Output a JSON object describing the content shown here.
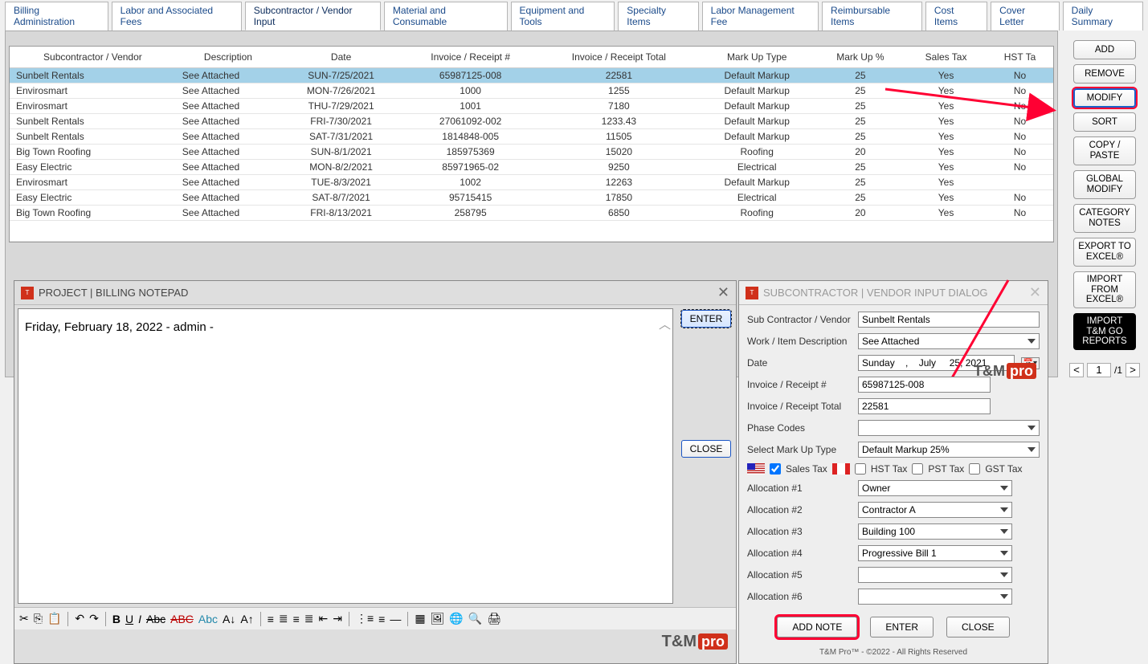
{
  "tabs": [
    {
      "label": "Billing Administration"
    },
    {
      "label": "Labor and Associated Fees"
    },
    {
      "label": "Subcontractor / Vendor Input",
      "active": true
    },
    {
      "label": "Material and Consumable"
    },
    {
      "label": "Equipment and Tools"
    },
    {
      "label": "Specialty Items"
    },
    {
      "label": "Labor Management Fee"
    },
    {
      "label": "Reimbursable Items"
    },
    {
      "label": "Cost Items"
    },
    {
      "label": "Cover Letter"
    },
    {
      "label": "Daily Summary"
    }
  ],
  "grid": {
    "columns": [
      "Subcontractor / Vendor",
      "Description",
      "Date",
      "Invoice / Receipt #",
      "Invoice / Receipt Total",
      "Mark Up Type",
      "Mark Up %",
      "Sales Tax",
      "HST Ta"
    ],
    "rows": [
      {
        "sel": true,
        "c": [
          "Sunbelt Rentals",
          "See Attached",
          "SUN-7/25/2021",
          "65987125-008",
          "22581",
          "Default Markup",
          "25",
          "Yes",
          "No"
        ]
      },
      {
        "c": [
          "Envirosmart",
          "See Attached",
          "MON-7/26/2021",
          "1000",
          "1255",
          "Default Markup",
          "25",
          "Yes",
          "No"
        ]
      },
      {
        "c": [
          "Envirosmart",
          "See Attached",
          "THU-7/29/2021",
          "1001",
          "7180",
          "Default Markup",
          "25",
          "Yes",
          "No"
        ]
      },
      {
        "c": [
          "Sunbelt Rentals",
          "See Attached",
          "FRI-7/30/2021",
          "27061092-002",
          "1233.43",
          "Default Markup",
          "25",
          "Yes",
          "No"
        ]
      },
      {
        "c": [
          "Sunbelt Rentals",
          "See Attached",
          "SAT-7/31/2021",
          "1814848-005",
          "11505",
          "Default Markup",
          "25",
          "Yes",
          "No"
        ]
      },
      {
        "c": [
          "Big Town Roofing",
          "See Attached",
          "SUN-8/1/2021",
          "185975369",
          "15020",
          "Roofing",
          "20",
          "Yes",
          "No"
        ]
      },
      {
        "c": [
          "Easy Electric",
          "See Attached",
          "MON-8/2/2021",
          "85971965-02",
          "9250",
          "Electrical",
          "25",
          "Yes",
          "No"
        ]
      },
      {
        "c": [
          "Envirosmart",
          "See Attached",
          "TUE-8/3/2021",
          "1002",
          "12263",
          "Default Markup",
          "25",
          "Yes",
          ""
        ]
      },
      {
        "c": [
          "Easy Electric",
          "See Attached",
          "SAT-8/7/2021",
          "95715415",
          "17850",
          "Electrical",
          "25",
          "Yes",
          "No"
        ]
      },
      {
        "c": [
          "Big Town Roofing",
          "See Attached",
          "FRI-8/13/2021",
          "258795",
          "6850",
          "Roofing",
          "20",
          "Yes",
          "No"
        ]
      }
    ]
  },
  "right_buttons": [
    {
      "label": "ADD"
    },
    {
      "label": "REMOVE"
    },
    {
      "label": "MODIFY",
      "hl": true
    },
    {
      "label": "SORT"
    },
    {
      "label": "COPY /\nPASTE",
      "tall": true
    },
    {
      "label": "GLOBAL\nMODIFY",
      "tall": true
    },
    {
      "label": "CATEGORY\nNOTES",
      "tall": true
    },
    {
      "label": "EXPORT TO\nEXCEL®",
      "tall": true
    },
    {
      "label": "IMPORT\nFROM\nEXCEL®",
      "tall": true
    },
    {
      "label": "IMPORT\nT&M GO\nREPORTS",
      "tall": true,
      "black": true
    }
  ],
  "pager": {
    "current": "1",
    "total": "/1"
  },
  "notepad": {
    "title": "PROJECT | BILLING NOTEPAD",
    "content": "Friday, February 18, 2022 - admin -",
    "enter": "ENTER",
    "close": "CLOSE"
  },
  "vendor": {
    "title": "SUBCONTRACTOR | VENDOR INPUT DIALOG",
    "fields": {
      "vendor_label": "Sub Contractor / Vendor",
      "vendor_value": "Sunbelt Rentals",
      "desc_label": "Work / Item Description",
      "desc_value": "See Attached",
      "date_label": "Date",
      "date_value": "Sunday    ,    July     25, 2021",
      "invnum_label": "Invoice / Receipt #",
      "invnum_value": "65987125-008",
      "invtot_label": "Invoice / Receipt Total",
      "invtot_value": "22581",
      "phase_label": "Phase Codes",
      "phase_value": "",
      "markup_label": "Select Mark Up Type",
      "markup_value": "Default Markup 25%",
      "salestax": "Sales Tax",
      "hst": "HST Tax",
      "pst": "PST Tax",
      "gst": "GST Tax",
      "alloc1": "Allocation #1",
      "alloc1v": "Owner",
      "alloc2": "Allocation #2",
      "alloc2v": "Contractor A",
      "alloc3": "Allocation #3",
      "alloc3v": "Building 100",
      "alloc4": "Allocation #4",
      "alloc4v": "Progressive Bill 1",
      "alloc5": "Allocation #5",
      "alloc5v": "",
      "alloc6": "Allocation #6",
      "alloc6v": ""
    },
    "add_note": "ADD NOTE",
    "enter": "ENTER",
    "close": "CLOSE",
    "copyright": "T&M Pro™ - ©2022 - All Rights Reserved"
  },
  "brand": {
    "tm": "T&M",
    "pro": "pro"
  }
}
